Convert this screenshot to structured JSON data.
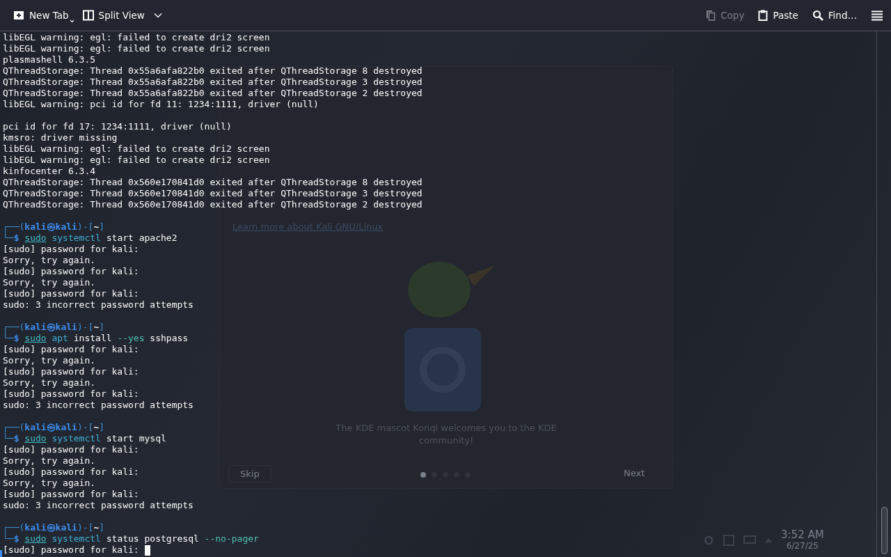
{
  "toolbar": {
    "left": [
      {
        "label": "New Tab",
        "kind": "new_tab"
      },
      {
        "label": "Split View",
        "kind": "split_view"
      }
    ],
    "right": [
      {
        "label": "Copy",
        "kind": "copy",
        "disabled": true
      },
      {
        "label": "Paste",
        "kind": "paste",
        "disabled": false
      },
      {
        "label": "Find…",
        "kind": "find",
        "disabled": false
      }
    ]
  },
  "terminal": {
    "lines": [
      {
        "kind": "output",
        "text": "libEGL warning: egl: failed to create dri2 screen"
      },
      {
        "kind": "output",
        "text": "libEGL warning: egl: failed to create dri2 screen"
      },
      {
        "kind": "output",
        "text": "plasmashell 6.3.5"
      },
      {
        "kind": "output",
        "text": "QThreadStorage: Thread 0x55a6afa822b0 exited after QThreadStorage 8 destroyed"
      },
      {
        "kind": "output",
        "text": "QThreadStorage: Thread 0x55a6afa822b0 exited after QThreadStorage 3 destroyed"
      },
      {
        "kind": "output",
        "text": "QThreadStorage: Thread 0x55a6afa822b0 exited after QThreadStorage 2 destroyed"
      },
      {
        "kind": "output",
        "text": "libEGL warning: pci id for fd 11: 1234:1111, driver (null)"
      },
      {
        "kind": "blank"
      },
      {
        "kind": "output",
        "text": "pci id for fd 17: 1234:1111, driver (null)"
      },
      {
        "kind": "output",
        "text": "kmsro: driver missing"
      },
      {
        "kind": "output",
        "text": "libEGL warning: egl: failed to create dri2 screen"
      },
      {
        "kind": "output",
        "text": "libEGL warning: egl: failed to create dri2 screen"
      },
      {
        "kind": "output",
        "text": "kinfocenter 6.3.4"
      },
      {
        "kind": "output",
        "text": "QThreadStorage: Thread 0x560e170841d0 exited after QThreadStorage 8 destroyed"
      },
      {
        "kind": "output",
        "text": "QThreadStorage: Thread 0x560e170841d0 exited after QThreadStorage 3 destroyed"
      },
      {
        "kind": "output",
        "text": "QThreadStorage: Thread 0x560e170841d0 exited after QThreadStorage 2 destroyed"
      },
      {
        "kind": "blank"
      },
      {
        "kind": "styled",
        "segments": [
          {
            "text": "┌──(",
            "kind": "frame"
          },
          {
            "text": "kali㉿kali",
            "kind": "user"
          },
          {
            "text": ")-[",
            "kind": "frame"
          },
          {
            "text": "~",
            "kind": "dir"
          },
          {
            "text": "]",
            "kind": "frame"
          }
        ]
      },
      {
        "kind": "styled",
        "segments": [
          {
            "text": "└─",
            "kind": "frame"
          },
          {
            "text": "$ ",
            "kind": "user"
          },
          {
            "text": "sudo",
            "kind": "builtin"
          },
          {
            "text": " systemctl",
            "kind": "command"
          },
          {
            "text": " start apache2",
            "kind": "arg"
          }
        ]
      },
      {
        "kind": "output",
        "text": "[sudo] password for kali:"
      },
      {
        "kind": "output",
        "text": "Sorry, try again."
      },
      {
        "kind": "output",
        "text": "[sudo] password for kali:"
      },
      {
        "kind": "output",
        "text": "Sorry, try again."
      },
      {
        "kind": "output",
        "text": "[sudo] password for kali:"
      },
      {
        "kind": "output",
        "text": "sudo: 3 incorrect password attempts"
      },
      {
        "kind": "blank"
      },
      {
        "kind": "styled",
        "segments": [
          {
            "text": "┌──(",
            "kind": "frame"
          },
          {
            "text": "kali㉿kali",
            "kind": "user"
          },
          {
            "text": ")-[",
            "kind": "frame"
          },
          {
            "text": "~",
            "kind": "dir"
          },
          {
            "text": "]",
            "kind": "frame"
          }
        ]
      },
      {
        "kind": "styled",
        "segments": [
          {
            "text": "└─",
            "kind": "frame"
          },
          {
            "text": "$ ",
            "kind": "user"
          },
          {
            "text": "sudo",
            "kind": "builtin"
          },
          {
            "text": " apt",
            "kind": "command"
          },
          {
            "text": " install",
            "kind": "arg"
          },
          {
            "text": " --yes",
            "kind": "option"
          },
          {
            "text": " sshpass",
            "kind": "arg"
          }
        ]
      },
      {
        "kind": "output",
        "text": "[sudo] password for kali:"
      },
      {
        "kind": "output",
        "text": "Sorry, try again."
      },
      {
        "kind": "output",
        "text": "[sudo] password for kali:"
      },
      {
        "kind": "output",
        "text": "Sorry, try again."
      },
      {
        "kind": "output",
        "text": "[sudo] password for kali:"
      },
      {
        "kind": "output",
        "text": "sudo: 3 incorrect password attempts"
      },
      {
        "kind": "blank"
      },
      {
        "kind": "styled",
        "segments": [
          {
            "text": "┌──(",
            "kind": "frame"
          },
          {
            "text": "kali㉿kali",
            "kind": "user"
          },
          {
            "text": ")-[",
            "kind": "frame"
          },
          {
            "text": "~",
            "kind": "dir"
          },
          {
            "text": "]",
            "kind": "frame"
          }
        ]
      },
      {
        "kind": "styled",
        "segments": [
          {
            "text": "└─",
            "kind": "frame"
          },
          {
            "text": "$ ",
            "kind": "user"
          },
          {
            "text": "sudo",
            "kind": "builtin"
          },
          {
            "text": " systemctl",
            "kind": "command"
          },
          {
            "text": " start mysql",
            "kind": "arg"
          }
        ]
      },
      {
        "kind": "output",
        "text": "[sudo] password for kali:"
      },
      {
        "kind": "output",
        "text": "Sorry, try again."
      },
      {
        "kind": "output",
        "text": "[sudo] password for kali:"
      },
      {
        "kind": "output",
        "text": "Sorry, try again."
      },
      {
        "kind": "output",
        "text": "[sudo] password for kali:"
      },
      {
        "kind": "output",
        "text": "sudo: 3 incorrect password attempts"
      },
      {
        "kind": "blank"
      },
      {
        "kind": "styled",
        "segments": [
          {
            "text": "┌──(",
            "kind": "frame"
          },
          {
            "text": "kali㉿kali",
            "kind": "user"
          },
          {
            "text": ")-[",
            "kind": "frame"
          },
          {
            "text": "~",
            "kind": "dir"
          },
          {
            "text": "]",
            "kind": "frame"
          }
        ]
      },
      {
        "kind": "styled",
        "segments": [
          {
            "text": "└─",
            "kind": "frame"
          },
          {
            "text": "$ ",
            "kind": "user"
          },
          {
            "text": "sudo",
            "kind": "builtin"
          },
          {
            "text": " systemctl",
            "kind": "command"
          },
          {
            "text": " status postgresql",
            "kind": "arg"
          },
          {
            "text": " --no-pager",
            "kind": "option"
          }
        ]
      },
      {
        "kind": "input",
        "text": "[sudo] password for kali: "
      }
    ]
  },
  "desktop": {
    "welcome": {
      "link": "Learn more about Kali GNU/Linux",
      "caption": "The KDE mascot Konqi welcomes you to the KDE community!",
      "skip": "Skip",
      "next": "Next",
      "pages": [
        {
          "selected": true
        },
        {
          "selected": false
        },
        {
          "selected": false
        },
        {
          "selected": false
        },
        {
          "selected": false
        }
      ]
    },
    "panel": {
      "time": "3:52 AM",
      "date": "6/27/25"
    }
  }
}
